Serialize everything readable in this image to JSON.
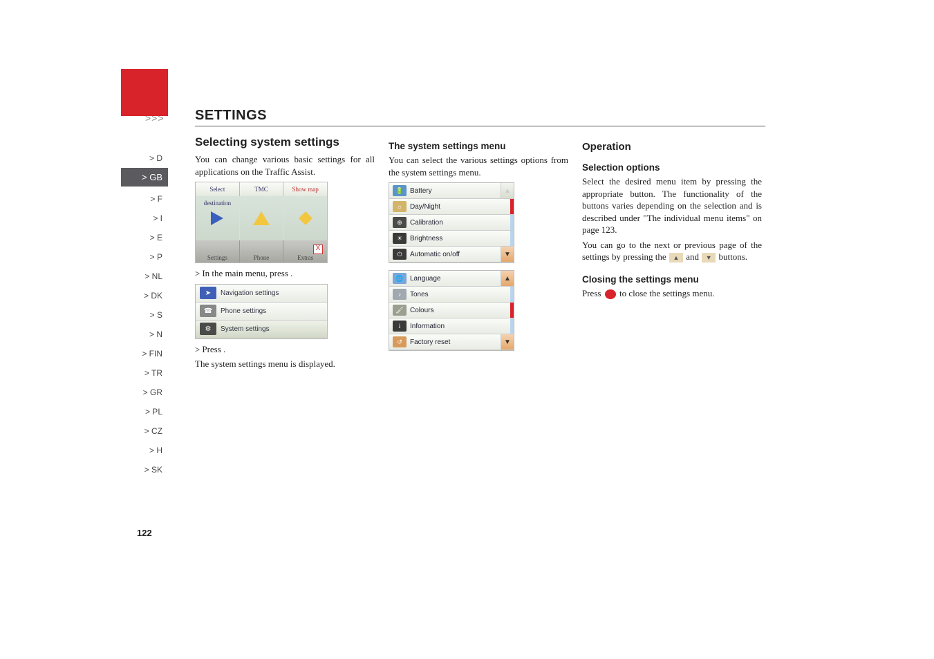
{
  "breadcrumb": {
    "arrows": ">>>",
    "title": "SETTINGS"
  },
  "sidebar": {
    "items": [
      {
        "label": "> D"
      },
      {
        "label": "> GB"
      },
      {
        "label": "> F"
      },
      {
        "label": "> I"
      },
      {
        "label": "> E"
      },
      {
        "label": "> P"
      },
      {
        "label": "> NL"
      },
      {
        "label": "> DK"
      },
      {
        "label": "> S"
      },
      {
        "label": "> N"
      },
      {
        "label": "> FIN"
      },
      {
        "label": "> TR"
      },
      {
        "label": "> GR"
      },
      {
        "label": "> PL"
      },
      {
        "label": "> CZ"
      },
      {
        "label": "> H"
      },
      {
        "label": "> SK"
      }
    ],
    "active_index": 1
  },
  "col1": {
    "heading": "Selecting system settings",
    "p1": "You can change various basic settings for all applications on the Traffic Assist.",
    "main_tabs": [
      "Select destination",
      "TMC",
      "Show map"
    ],
    "main_bottom": [
      "Settings",
      "Phone",
      "Extras"
    ],
    "close_x": "X",
    "step1_prefix": "> ",
    "step1": "In the main menu, press ",
    "step1_suffix": ".",
    "settings_list": [
      {
        "label": "Navigation settings"
      },
      {
        "label": "Phone settings"
      },
      {
        "label": "System settings"
      }
    ],
    "step2_prefix": "> ",
    "step2": "Press ",
    "step2_suffix": ".",
    "p2": "The system settings menu is displayed."
  },
  "col2": {
    "heading": "The system settings menu",
    "p1": "You can select the various settings options from the system settings menu.",
    "menu_top": [
      {
        "label": "Battery",
        "icon_bg": "#5a94c8"
      },
      {
        "label": "Day/Night",
        "icon_bg": "#d2b46a"
      },
      {
        "label": "Calibration",
        "icon_bg": "#4a4a48"
      },
      {
        "label": "Brightness",
        "icon_bg": "#3a3a38"
      },
      {
        "label": "Automatic on/off",
        "icon_bg": "#3a3a38"
      }
    ],
    "menu_bottom": [
      {
        "label": "Language",
        "icon_bg": "#7aa6d8"
      },
      {
        "label": "Tones",
        "icon_bg": "#a0a8b0"
      },
      {
        "label": "Colours",
        "icon_bg": "#9aa090"
      },
      {
        "label": "Information",
        "icon_bg": "#3a3a38"
      },
      {
        "label": "Factory reset",
        "icon_bg": "#d89a5a"
      }
    ],
    "nav_up": "▲",
    "nav_down": "▼"
  },
  "col3": {
    "heading": "Operation",
    "sub1": "Selection options",
    "p1": "Select the desired menu item by pressing the appropriate button. The functionality of the buttons varies depending on the selection and is described under \"The individual menu items\" on page 123.",
    "p2a": "You can go to the next or previous page of the settings by pressing the ",
    "p2b": " and ",
    "p2c": " buttons.",
    "arrow_up": "▲",
    "arrow_down": "▼",
    "sub2": "Closing the settings menu",
    "p3a": "Press ",
    "p3b": " to close the settings menu."
  },
  "page_number": "122"
}
